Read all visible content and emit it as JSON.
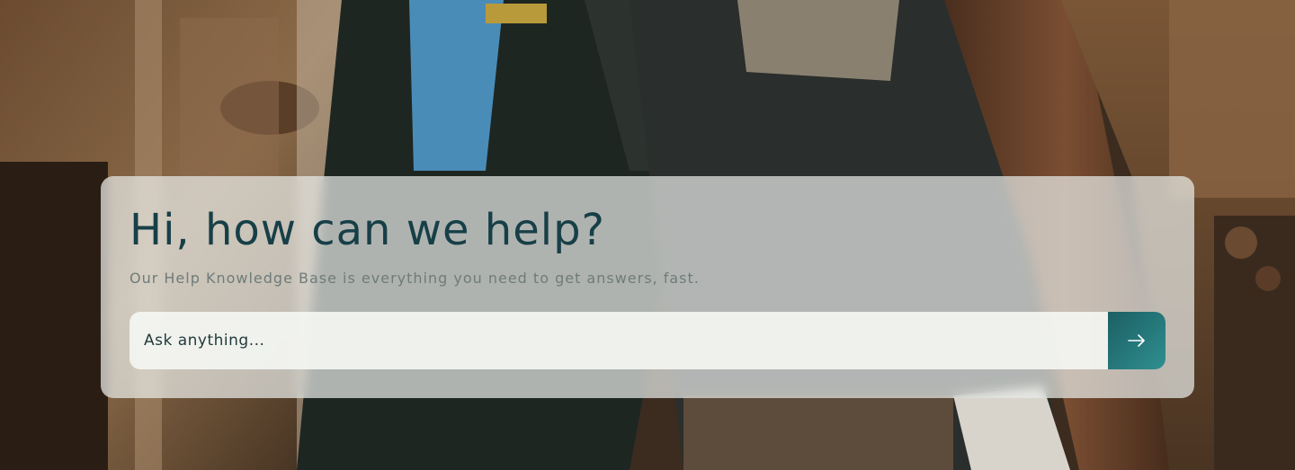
{
  "hero": {
    "title": "Hi, how can we help?",
    "subtitle": "Our Help Knowledge Base is everything you need to get answers, fast."
  },
  "search": {
    "placeholder": "Ask anything...",
    "value": "",
    "submit_icon": "arrow-right-icon"
  },
  "colors": {
    "title": "#173f47",
    "subtitle": "#6f7c78",
    "button": "#1f6b6e",
    "card": "#ecf0ec"
  }
}
